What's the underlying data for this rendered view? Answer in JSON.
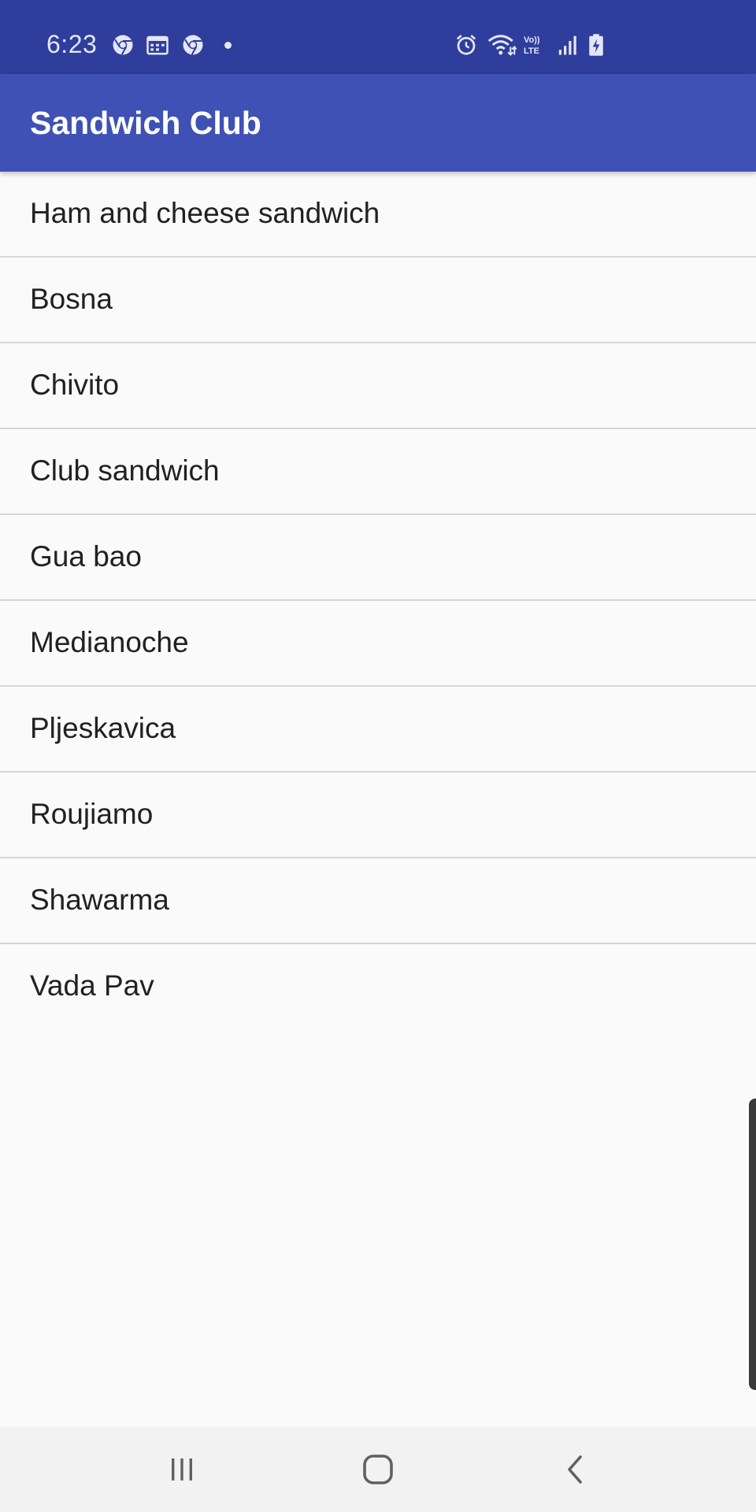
{
  "status_bar": {
    "time": "6:23",
    "background": "#2f3d9c",
    "left_icons": [
      "chrome-icon",
      "calendar-icon",
      "chrome-icon",
      "notification-dot"
    ],
    "right_icons": [
      "alarm-icon",
      "wifi-icon",
      "volte-icon",
      "signal-icon",
      "battery-charging-icon"
    ],
    "volte_label": "Vo)) LTE"
  },
  "app_bar": {
    "title": "Sandwich Club",
    "color": "#3f51b5"
  },
  "sandwiches": [
    "Ham and cheese sandwich",
    "Bosna",
    "Chivito",
    "Club sandwich",
    "Gua bao",
    "Medianoche",
    "Pljeskavica",
    "Roujiamo",
    "Shawarma",
    "Vada Pav"
  ],
  "nav_bar": {
    "buttons": [
      "recents-icon",
      "home-icon",
      "back-icon"
    ]
  }
}
